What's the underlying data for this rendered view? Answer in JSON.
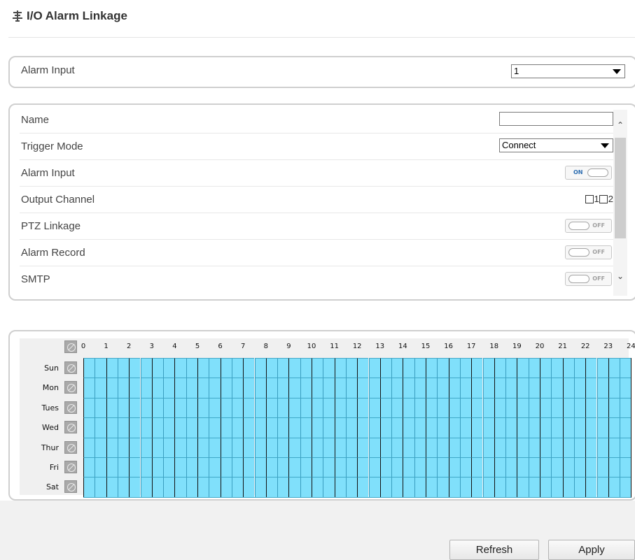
{
  "page": {
    "title": "I/O Alarm Linkage",
    "icon": "network-io-icon"
  },
  "alarm_input_selector": {
    "label": "Alarm Input",
    "value": "1"
  },
  "settings": {
    "name": {
      "label": "Name",
      "value": ""
    },
    "trigger_mode": {
      "label": "Trigger Mode",
      "value": "Connect"
    },
    "alarm_input": {
      "label": "Alarm Input",
      "state": "ON"
    },
    "output_channel": {
      "label": "Output Channel",
      "options": [
        "1",
        "2"
      ],
      "checked": [
        false,
        false
      ]
    },
    "ptz_linkage": {
      "label": "PTZ Linkage",
      "state": "OFF"
    },
    "alarm_record": {
      "label": "Alarm Record",
      "state": "OFF"
    },
    "smtp": {
      "label": "SMTP",
      "state": "OFF"
    }
  },
  "schedule": {
    "days": [
      "Sun",
      "Mon",
      "Tues",
      "Wed",
      "Thur",
      "Fri",
      "Sat"
    ],
    "hours": [
      "0",
      "1",
      "2",
      "3",
      "4",
      "5",
      "6",
      "7",
      "8",
      "9",
      "10",
      "11",
      "12",
      "13",
      "14",
      "15",
      "16",
      "17",
      "18",
      "19",
      "20",
      "21",
      "22",
      "23",
      "24"
    ],
    "slots_per_hour": 2,
    "all_selected": true,
    "selected_color": "#80e0fb"
  },
  "buttons": {
    "refresh": "Refresh",
    "apply": "Apply"
  }
}
